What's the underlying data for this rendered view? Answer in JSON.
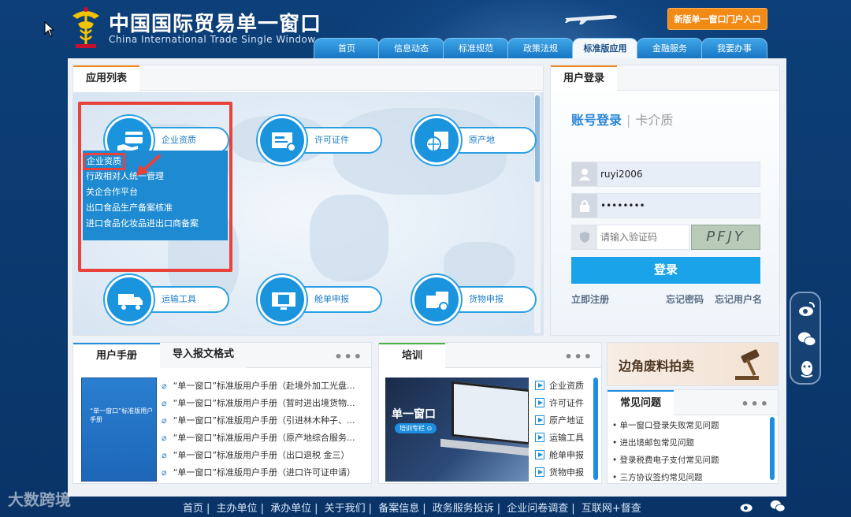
{
  "header": {
    "title_cn": "中国国际贸易单一窗口",
    "title_en": "China International Trade Single Window",
    "portal_button": "新版单一窗口门户入口"
  },
  "nav": [
    {
      "label": "首页"
    },
    {
      "label": "信息动态"
    },
    {
      "label": "标准规范"
    },
    {
      "label": "政策法规"
    },
    {
      "label": "标准版应用",
      "active": true
    },
    {
      "label": "金融服务"
    },
    {
      "label": "我要办事"
    }
  ],
  "apps": {
    "tab": "应用列表",
    "items": [
      {
        "label": "企业资质",
        "icon": "card-hand-icon"
      },
      {
        "label": "许可证件",
        "icon": "document-check-icon"
      },
      {
        "label": "原产地",
        "icon": "globe-document-icon"
      },
      {
        "label": "运输工具",
        "icon": "truck-icon"
      },
      {
        "label": "舱单申报",
        "icon": "monitor-document-icon"
      },
      {
        "label": "货物申报",
        "icon": "goods-document-icon"
      }
    ],
    "dropdown": [
      "企业资质",
      "行政相对人统一管理",
      "关企合作平台",
      "出口食品生产备案核准",
      "进口食品化妆品进出口商备案"
    ]
  },
  "login": {
    "tab": "用户登录",
    "mode_active": "账号登录",
    "mode_other": "卡介质",
    "username": "ruyi2006",
    "password": "••••••••",
    "captcha_placeholder": "请输入验证码",
    "captcha_text": "PFJY",
    "submit": "登录",
    "register": "立即注册",
    "forgot_password": "忘记密码",
    "forgot_username": "忘记用户名"
  },
  "manual": {
    "tab_active": "用户手册",
    "tab_other": "导入报文格式",
    "more": "•••",
    "book_title": "“单一窗口”标准版用户手册",
    "items": [
      "“单一窗口”标准版用户手册（赴境外加工光盘...",
      "“单一窗口”标准版用户手册（暂时进出境货物...",
      "“单一窗口”标准版用户手册（引进林木种子、...",
      "“单一窗口”标准版用户手册（原产地综合服务...",
      "“单一窗口”标准版用户手册（出口退税 金三）",
      "“单一窗口”标准版用户手册（进口许可证申请）"
    ]
  },
  "training": {
    "tab": "培训",
    "more": "•••",
    "image_title": "单一窗口",
    "image_sub": "培训专栏 ⊙",
    "items": [
      "企业资质",
      "许可证件",
      "原产地证",
      "运输工具",
      "舱单申报",
      "货物申报"
    ]
  },
  "banner": {
    "text": "边角废料拍卖"
  },
  "faq": {
    "tab": "常见问题",
    "more": "•••",
    "items": [
      "• 单一窗口登录失败常见问题",
      "• 进出境邮包常见问题",
      "• 登录税费电子支付常见问题",
      "• 三方协议签约常见问题"
    ]
  },
  "footer": {
    "links": [
      "首页",
      "主办单位",
      "承办单位",
      "关于我们",
      "备案信息",
      "政务服务投诉",
      "企业问卷调查",
      "互联网+督查"
    ],
    "watermark": "大数跨境"
  },
  "colors": {
    "background": "#0b3a70",
    "accent_blue": "#1b94de",
    "orange": "#f28a16",
    "highlight_red": "#e8423b"
  }
}
